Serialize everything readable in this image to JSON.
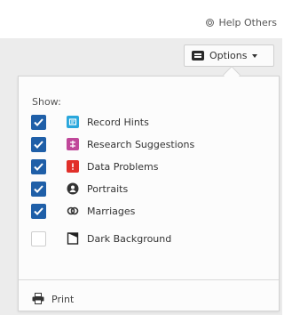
{
  "header": {
    "help_label": "Help Others",
    "help_icon": "help-circle-icon"
  },
  "options_button": {
    "label": "Options",
    "icon": "options-icon",
    "caret_icon": "caret-down-icon"
  },
  "panel": {
    "show_label": "Show:",
    "items": [
      {
        "label": "Record Hints",
        "checked": true,
        "icon": "record-hints-icon",
        "icon_color": "#2aa7dc"
      },
      {
        "label": "Research Suggestions",
        "checked": true,
        "icon": "research-suggestions-icon",
        "icon_color": "#c0479a"
      },
      {
        "label": "Data Problems",
        "checked": true,
        "icon": "data-problems-icon",
        "icon_color": "#e1302a"
      },
      {
        "label": "Portraits",
        "checked": true,
        "icon": "portraits-icon",
        "icon_color": "#333333"
      },
      {
        "label": "Marriages",
        "checked": true,
        "icon": "marriages-icon",
        "icon_color": "#333333"
      },
      {
        "label": "Dark Background",
        "checked": false,
        "icon": "dark-background-icon",
        "icon_color": "#222222"
      }
    ],
    "print_label": "Print",
    "print_icon": "print-icon"
  },
  "colors": {
    "checkbox_checked": "#1f5fa8",
    "gray_background": "#ececec"
  }
}
